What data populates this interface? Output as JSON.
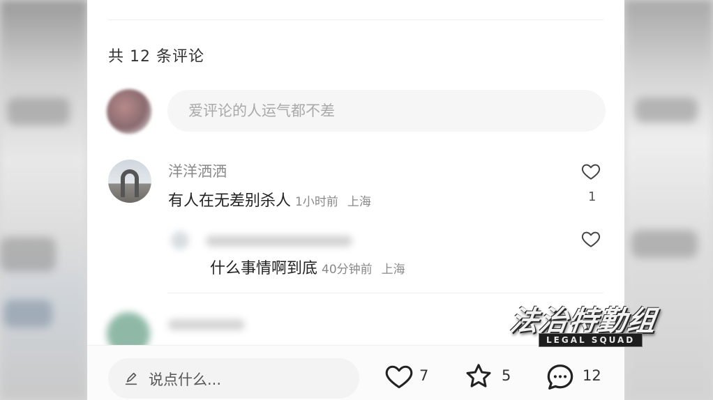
{
  "comments_section": {
    "count_label": "共 12 条评论",
    "input_placeholder": "爱评论的人运气都不差"
  },
  "comments": [
    {
      "username": "洋洋洒洒",
      "text": "有人在无差别杀人",
      "time": "1小时前",
      "location": "上海",
      "likes": "1"
    }
  ],
  "reply": {
    "text": "什么事情啊到底",
    "time": "40分钟前",
    "location": "上海"
  },
  "bottom_bar": {
    "input_placeholder": "说点什么...",
    "likes": "7",
    "favorites": "5",
    "comments": "12"
  },
  "watermark": {
    "title": "法治特勤组",
    "subtitle": "LEGAL SQUAD"
  },
  "icons": {
    "heart": "heart-icon",
    "star": "star-icon",
    "chat": "chat-bubble-icon",
    "pen": "pen-icon"
  }
}
